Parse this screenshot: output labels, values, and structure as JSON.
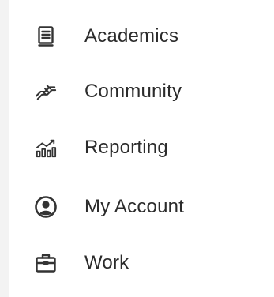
{
  "menu": {
    "items": [
      {
        "label": "Academics",
        "icon": "book-icon"
      },
      {
        "label": "Community",
        "icon": "handshake-icon"
      },
      {
        "label": "Reporting",
        "icon": "chart-icon"
      },
      {
        "label": "My Account",
        "icon": "user-circle-icon"
      },
      {
        "label": "Work",
        "icon": "briefcase-icon"
      }
    ]
  },
  "colors": {
    "background": "#f3f3f3",
    "panel": "#ffffff",
    "text": "#2b2b2b",
    "icon": "#333333"
  }
}
